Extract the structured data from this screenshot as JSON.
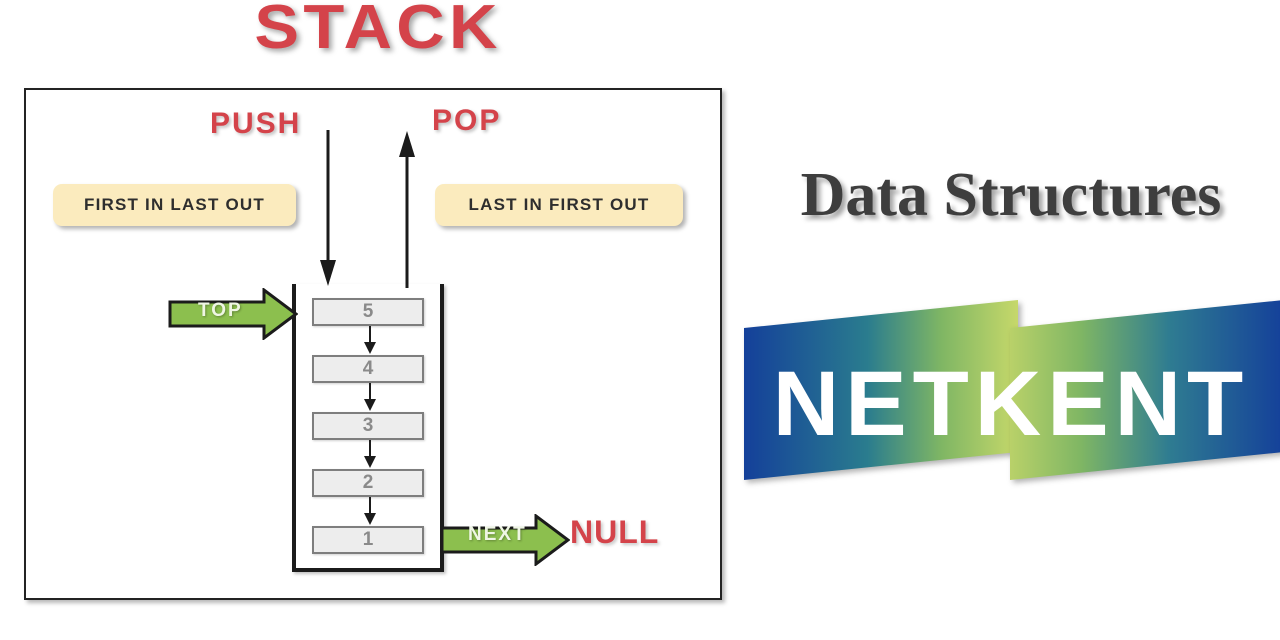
{
  "title": "STACK",
  "diagram": {
    "operations": {
      "push_label": "PUSH",
      "pop_label": "POP"
    },
    "info_boxes": [
      {
        "name": "first-in-last-out",
        "text": "FIRST IN LAST OUT"
      },
      {
        "name": "last-in-first-out",
        "text": "LAST IN FIRST OUT"
      }
    ],
    "pointers": {
      "top_label": "TOP",
      "next_label": "NEXT",
      "null_label": "NULL"
    },
    "stack_items": [
      "5",
      "4",
      "3",
      "2",
      "1"
    ]
  },
  "right_panel": {
    "heading": "Data Structures",
    "logo": {
      "text": "NETKENT",
      "part_one": "NETK",
      "part_two": "ENT"
    }
  },
  "colors": {
    "title_red": "#D4434A",
    "info_box_yellow": "#FBEBBE",
    "arrow_green": "#8CBF4E",
    "stack_box_gray": "#EDEDED",
    "stack_text_gray": "#8A8A8A",
    "logo_blue": "#14409A",
    "logo_green": "#A6C757",
    "heading_gray": "#3E3E3E",
    "frame_black": "#232323"
  }
}
